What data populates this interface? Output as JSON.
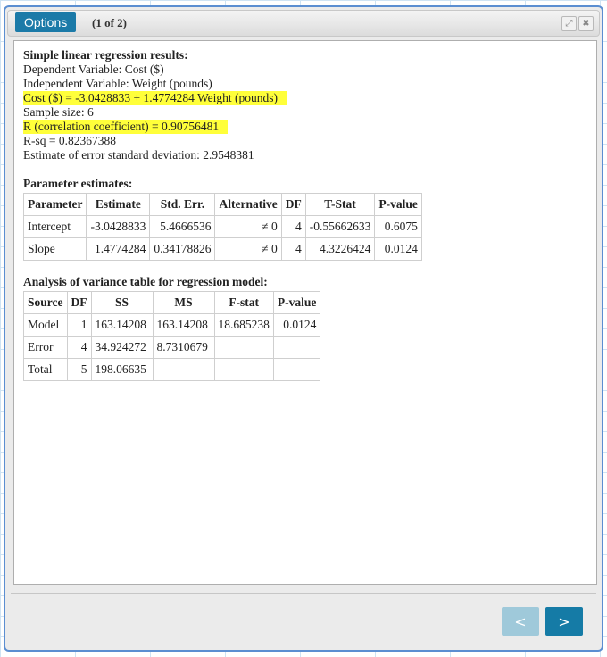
{
  "window": {
    "options_label": "Options",
    "page_count": "(1 of 2)",
    "icons": [
      "expand-icon",
      "close-icon"
    ]
  },
  "results": {
    "heading": "Simple linear regression results:",
    "dependent": "Dependent Variable: Cost ($)",
    "independent": "Independent Variable: Weight (pounds)",
    "equation": "Cost ($) = -3.0428833 + 1.4774284 Weight (pounds)",
    "sample_size": "Sample size: 6",
    "correlation": "R (correlation coefficient) = 0.90756481",
    "rsq": "R-sq = 0.82367388",
    "error_sd": "Estimate of error standard deviation: 2.9548381",
    "highlight_color": "#ffff3a"
  },
  "parameters": {
    "title": "Parameter estimates:",
    "headers": [
      "Parameter",
      "Estimate",
      "Std. Err.",
      "Alternative",
      "DF",
      "T-Stat",
      "P-value"
    ],
    "rows": [
      [
        "Intercept",
        "-3.0428833",
        "5.4666536",
        "≠ 0",
        "4",
        "-0.55662633",
        "0.6075"
      ],
      [
        "Slope",
        "1.4774284",
        "0.34178826",
        "≠ 0",
        "4",
        "4.3226424",
        "0.0124"
      ]
    ]
  },
  "anova": {
    "title": "Analysis of variance table for regression model:",
    "headers": [
      "Source",
      "DF",
      "SS",
      "MS",
      "F-stat",
      "P-value"
    ],
    "rows": [
      [
        "Model",
        "1",
        "163.14208",
        "163.14208",
        "18.685238",
        "0.0124"
      ],
      [
        "Error",
        "4",
        "34.924272",
        "8.7310679",
        "",
        ""
      ],
      [
        "Total",
        "5",
        "198.06635",
        "",
        "",
        ""
      ]
    ]
  },
  "nav": {
    "prev_label": "<",
    "next_label": ">"
  },
  "colors": {
    "accent": "#1b7aa8",
    "disabled": "#9fc9da"
  }
}
